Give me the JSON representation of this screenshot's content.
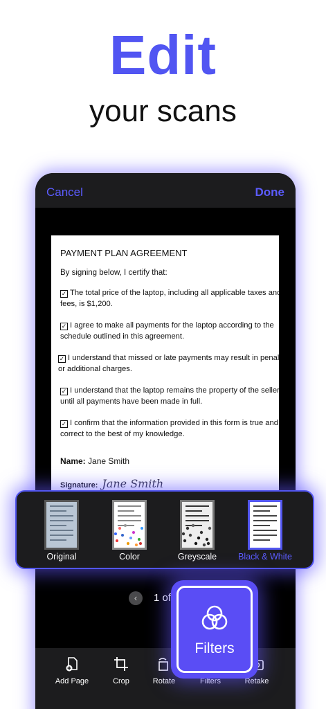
{
  "headline": "Edit",
  "subhead": "your scans",
  "nav": {
    "cancel": "Cancel",
    "done": "Done"
  },
  "document": {
    "title": "PAYMENT PLAN AGREEMENT",
    "intro": "By signing below, I certify that:",
    "items": [
      {
        "line1": "The total price of the laptop, including all applicable taxes and",
        "line2": "fees, is $1,200."
      },
      {
        "line1": "I agree to make all payments for the laptop according to the",
        "line2": "schedule outlined in this agreement."
      },
      {
        "line1": "I understand that missed or late payments may result in penalties",
        "line2": "or additional charges."
      },
      {
        "line1": "I understand that the laptop remains the property of the seller",
        "line2": "until all payments have been made in full."
      },
      {
        "line1": "I confirm that the information provided in this form is true and",
        "line2": "correct to the best of my knowledge."
      }
    ],
    "name_label": "Name:",
    "name_value": "Jane Smith",
    "signature_label": "Signature:",
    "signature_value": "Jane Smith"
  },
  "filters": [
    {
      "label": "Original"
    },
    {
      "label": "Color"
    },
    {
      "label": "Greyscale"
    },
    {
      "label": "Black & White"
    }
  ],
  "selected_filter": "Black & White",
  "pager": {
    "prev_icon": "chevron-left-icon",
    "text": "1 of"
  },
  "toolbar": {
    "add_page": "Add Page",
    "crop": "Crop",
    "rotate": "Rotate",
    "filters": "Filters",
    "retake": "Retake"
  },
  "filters_button": {
    "label": "Filters",
    "icon": "filters-icon"
  },
  "colors": {
    "accent": "#5155f2",
    "toolbar_bg": "#1c1c1e",
    "button_bg": "#5a4df5"
  }
}
